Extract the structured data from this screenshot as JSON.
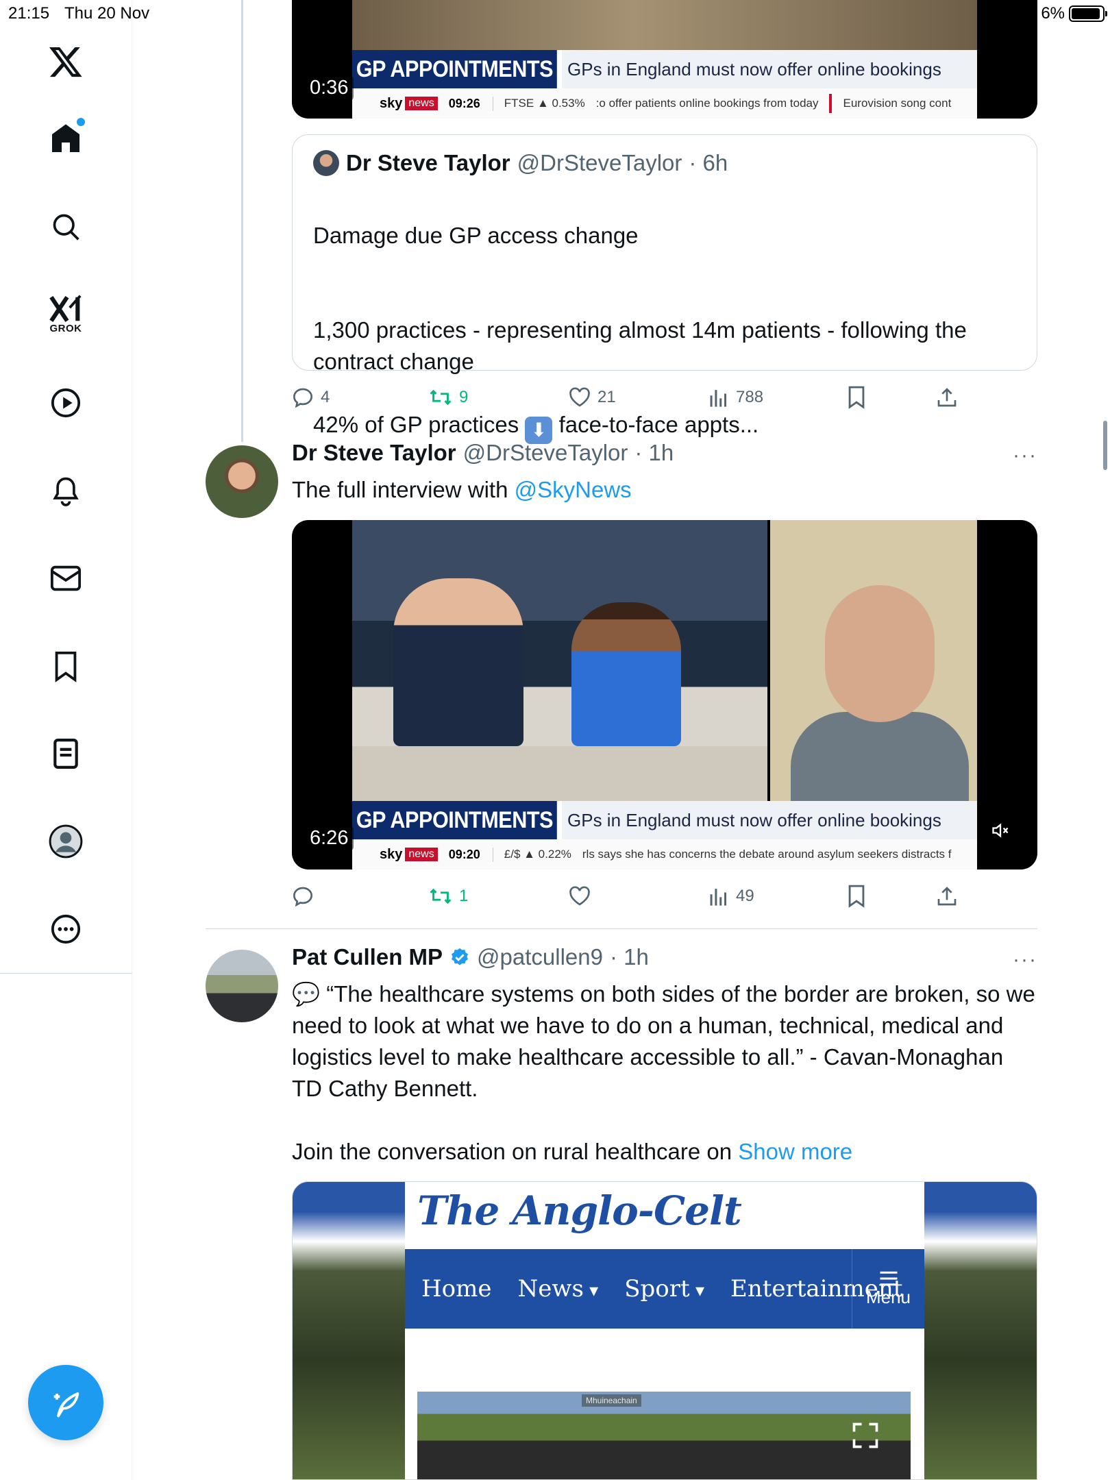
{
  "status": {
    "time": "21:15",
    "date": "Thu 20 Nov",
    "battery": "6%",
    "battery_level": 0.94
  },
  "sidebar": {
    "items": [
      {
        "name": "home",
        "label": ""
      },
      {
        "name": "explore",
        "label": ""
      },
      {
        "name": "grok",
        "label": "GROK"
      },
      {
        "name": "video",
        "label": ""
      },
      {
        "name": "notifications",
        "label": ""
      },
      {
        "name": "messages",
        "label": ""
      },
      {
        "name": "bookmarks",
        "label": ""
      },
      {
        "name": "lists",
        "label": ""
      },
      {
        "name": "profile",
        "label": ""
      },
      {
        "name": "more",
        "label": ""
      }
    ]
  },
  "video1": {
    "duration": "0:36",
    "headline_tag": "GP APPOINTMENTS",
    "headline_text": "GPs in England must now offer online bookings",
    "brand": "sky",
    "brand_badge": "news",
    "clock": "09:26",
    "ticker_index": "FTSE ▲ 0.53%",
    "ticker_text": ":o offer patients online bookings from today",
    "ticker_text2": "Eurovision song cont"
  },
  "quote": {
    "name": "Dr Steve Taylor",
    "handle": "@DrSteveTaylor",
    "time": "· 6h",
    "line1": "Damage due GP access change",
    "line2": "1,300 practices - representing almost 14m patients - following the contract change",
    "line3_pre": "42% of GP practices",
    "line3_emoji": "⬇",
    "line3_post": "face-to-face appts..."
  },
  "actions1": {
    "replies": "4",
    "reposts": "9",
    "likes": "21",
    "views": "788"
  },
  "tweet2": {
    "name": "Dr Steve Taylor",
    "handle": "@DrSteveTaylor",
    "time": "· 1h",
    "more": "···",
    "text_pre": "The full interview with ",
    "text_link": "@SkyNews"
  },
  "video2": {
    "duration": "6:26",
    "headline_tag": "GP APPOINTMENTS",
    "headline_text": "GPs in England must now offer online bookings",
    "brand": "sky",
    "brand_badge": "news",
    "clock": "09:20",
    "ticker_index": "£/$ ▲ 0.22%",
    "ticker_text": "rls says she has concerns the debate around asylum seekers distracts f"
  },
  "actions2": {
    "replies": "",
    "reposts": "1",
    "likes": "",
    "views": "49"
  },
  "tweet3": {
    "name": "Pat Cullen MP",
    "handle": "@patcullen9",
    "time": "· 1h",
    "more": "···",
    "text": "💬 “The healthcare systems on both sides of the border are broken, so we need to look at what we have to do on a human, technical, medical and logistics level to make healthcare accessible to all.” - Cavan-Monaghan TD Cathy Bennett.",
    "text2_pre": "Join the conversation on rural healthcare on ",
    "text2_link": "Show more"
  },
  "card": {
    "logo": "The Anglo-Celt",
    "nav": [
      "Home",
      "News",
      "Sport",
      "Entertainment"
    ],
    "menu_label": "Menu",
    "sign_text": "Mhuineachain"
  },
  "colors": {
    "accent": "#1d9bf0",
    "repost": "#00ba7c",
    "muted": "#536471",
    "sky_navy": "#0d2b6b",
    "sky_red": "#c8102e",
    "celt_blue": "#1e4fa3"
  }
}
